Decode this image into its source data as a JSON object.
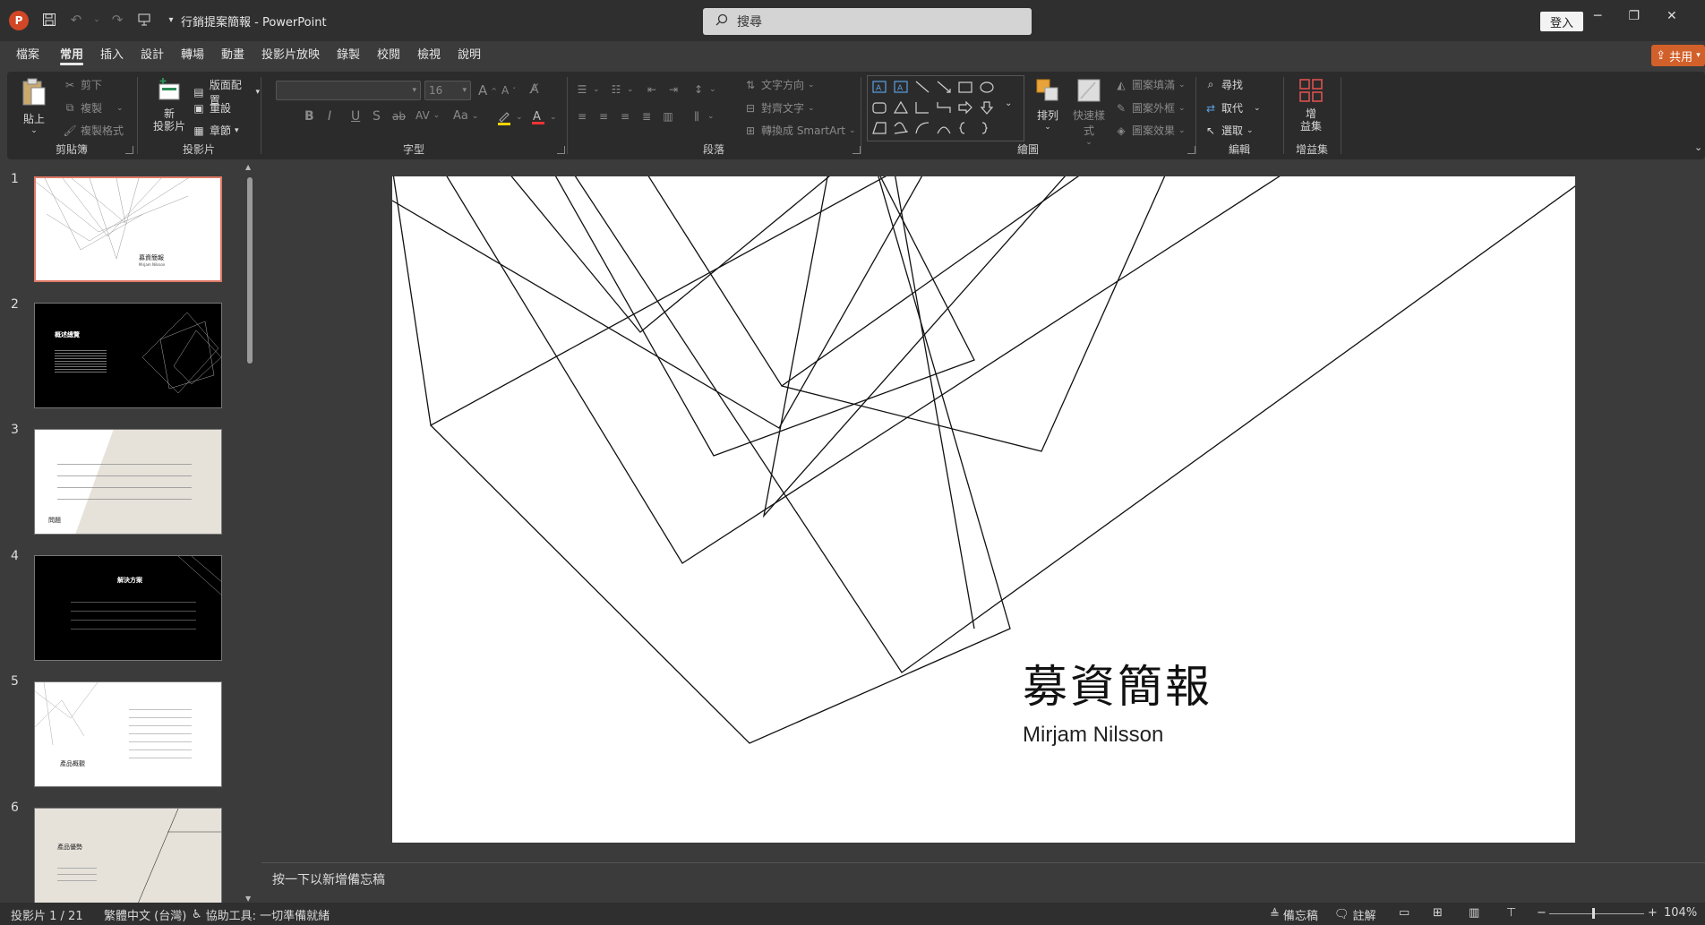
{
  "titlebar": {
    "app_logo": "P",
    "doc_title": "行銷提案簡報 - PowerPoint",
    "search_placeholder": "搜尋",
    "signin_label": "登入",
    "qat_icons": [
      "save-icon",
      "undo-icon",
      "redo-icon",
      "present-icon",
      "customize-icon"
    ],
    "window_controls": [
      "minimize-icon",
      "restore-icon",
      "close-icon"
    ]
  },
  "tabs": [
    "檔案",
    "常用",
    "插入",
    "設計",
    "轉場",
    "動畫",
    "投影片放映",
    "錄製",
    "校閱",
    "檢視",
    "說明"
  ],
  "active_tab": "常用",
  "share_label": "共用",
  "ribbon": {
    "clipboard": {
      "label": "剪貼簿",
      "paste": "貼上",
      "cut": "剪下",
      "copy": "複製",
      "format_painter": "複製格式"
    },
    "slides": {
      "label": "投影片",
      "new_slide": "新\n投影片",
      "layout": "版面配置",
      "reset": "重設",
      "section": "章節"
    },
    "font": {
      "label": "字型",
      "font_name": "",
      "font_size": "16",
      "bold": "B",
      "italic": "I",
      "underline": "U",
      "strike": "S",
      "strikethrough": "ab",
      "spacing": "AV",
      "case": "Aa",
      "grow": "A",
      "shrink": "A"
    },
    "paragraph": {
      "label": "段落",
      "text_direction": "文字方向",
      "align_text": "對齊文字",
      "smartart": "轉換成 SmartArt"
    },
    "drawing": {
      "label": "繪圖",
      "arrange": "排列",
      "quick_styles": "快速樣式",
      "fill": "圖案填滿",
      "outline": "圖案外框",
      "effects": "圖案效果"
    },
    "editing": {
      "label": "編輯",
      "find": "尋找",
      "replace": "取代",
      "select": "選取"
    },
    "addins": {
      "label": "增益集",
      "button": "增\n益集"
    }
  },
  "thumbnails": [
    {
      "num": "1",
      "title": "募資簡報",
      "subtitle": "Mirjam Nilsson",
      "theme": "light"
    },
    {
      "num": "2",
      "title": "概述總覽",
      "theme": "dark"
    },
    {
      "num": "3",
      "title": "問題",
      "theme": "beige"
    },
    {
      "num": "4",
      "title": "解決方案",
      "theme": "dark"
    },
    {
      "num": "5",
      "title": "產品概觀",
      "theme": "light"
    },
    {
      "num": "6",
      "title": "產品優勢",
      "theme": "beige"
    }
  ],
  "slide": {
    "title": "募資簡報",
    "subtitle": "Mirjam Nilsson"
  },
  "notes_placeholder": "按一下以新增備忘稿",
  "status": {
    "slide_count": "投影片 1 / 21",
    "language": "繁體中文 (台灣)",
    "accessibility": "協助工具: 一切準備就緒",
    "notes": "備忘稿",
    "comments": "註解",
    "zoom": "104%"
  }
}
